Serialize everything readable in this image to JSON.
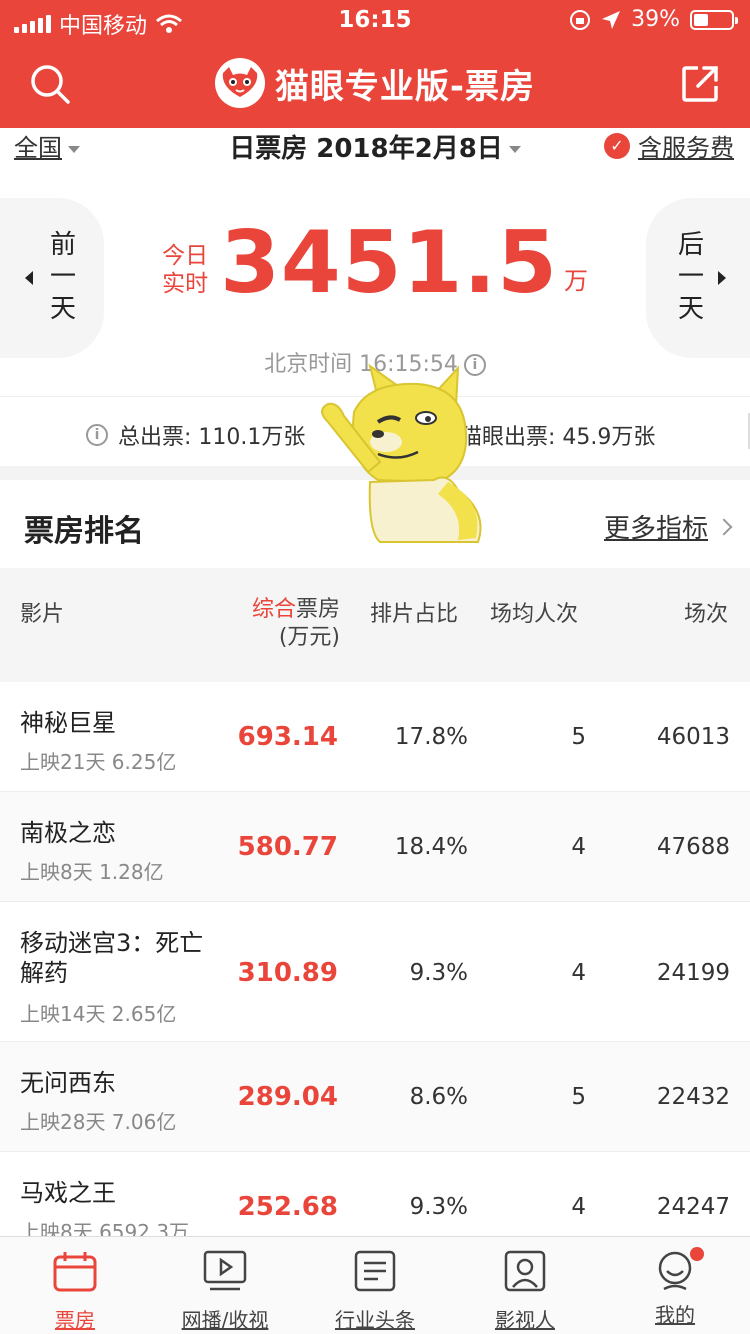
{
  "status_bar": {
    "carrier": "中国移动",
    "time": "16:15",
    "battery": "39%",
    "battery_level": 0.39
  },
  "nav": {
    "title": "猫眼专业版-票房",
    "icons": [
      "search-icon",
      "maoyan-logo-icon",
      "share-icon"
    ]
  },
  "filters": {
    "region": "全国",
    "date_label": "日票房 2018年2月8日",
    "fee_label": "含服务费",
    "fee_checked": true
  },
  "hero": {
    "prev_label": "前一天",
    "next_label": "后一天",
    "realtime_label": "今日实时",
    "amount": "3451.5",
    "unit": "万",
    "beijing_time": "北京时间 16:15:54"
  },
  "tickets": {
    "total": "总出票: 110.1万张",
    "maoyan": "猫眼出票: 45.9万张"
  },
  "ranking": {
    "title": "票房排名",
    "more": "更多指标",
    "headers": {
      "film": "影片",
      "bo_highlight": "综合",
      "bo_rest": "票房",
      "bo_unit": "(万元)",
      "share": "排片占比",
      "avg": "场均人次",
      "shows": "场次"
    },
    "rows": [
      {
        "name": "神秘巨星",
        "sub": "上映21天 6.25亿",
        "bo": "693.14",
        "share": "17.8%",
        "avg": "5",
        "shows": "46013"
      },
      {
        "name": "南极之恋",
        "sub": "上映8天 1.28亿",
        "bo": "580.77",
        "share": "18.4%",
        "avg": "4",
        "shows": "47688"
      },
      {
        "name": "移动迷宫3：死亡解药",
        "sub": "上映14天 2.65亿",
        "bo": "310.89",
        "share": "9.3%",
        "avg": "4",
        "shows": "24199"
      },
      {
        "name": "无问西东",
        "sub": "上映28天 7.06亿",
        "bo": "289.04",
        "share": "8.6%",
        "avg": "5",
        "shows": "22432"
      },
      {
        "name": "马戏之王",
        "sub": "上映8天 6592.3万",
        "bo": "252.68",
        "share": "9.3%",
        "avg": "4",
        "shows": "24247"
      }
    ]
  },
  "tabs": [
    {
      "label": "票房",
      "icon": "calendar-icon",
      "active": true
    },
    {
      "label": "网播/收视",
      "icon": "play-icon",
      "active": false
    },
    {
      "label": "行业头条",
      "icon": "news-icon",
      "active": false
    },
    {
      "label": "影视人",
      "icon": "person-card-icon",
      "active": false
    },
    {
      "label": "我的",
      "icon": "profile-icon",
      "active": false,
      "badge": true
    }
  ],
  "colors": {
    "brand": "#e9453b",
    "mascot": "#f2e14a"
  }
}
